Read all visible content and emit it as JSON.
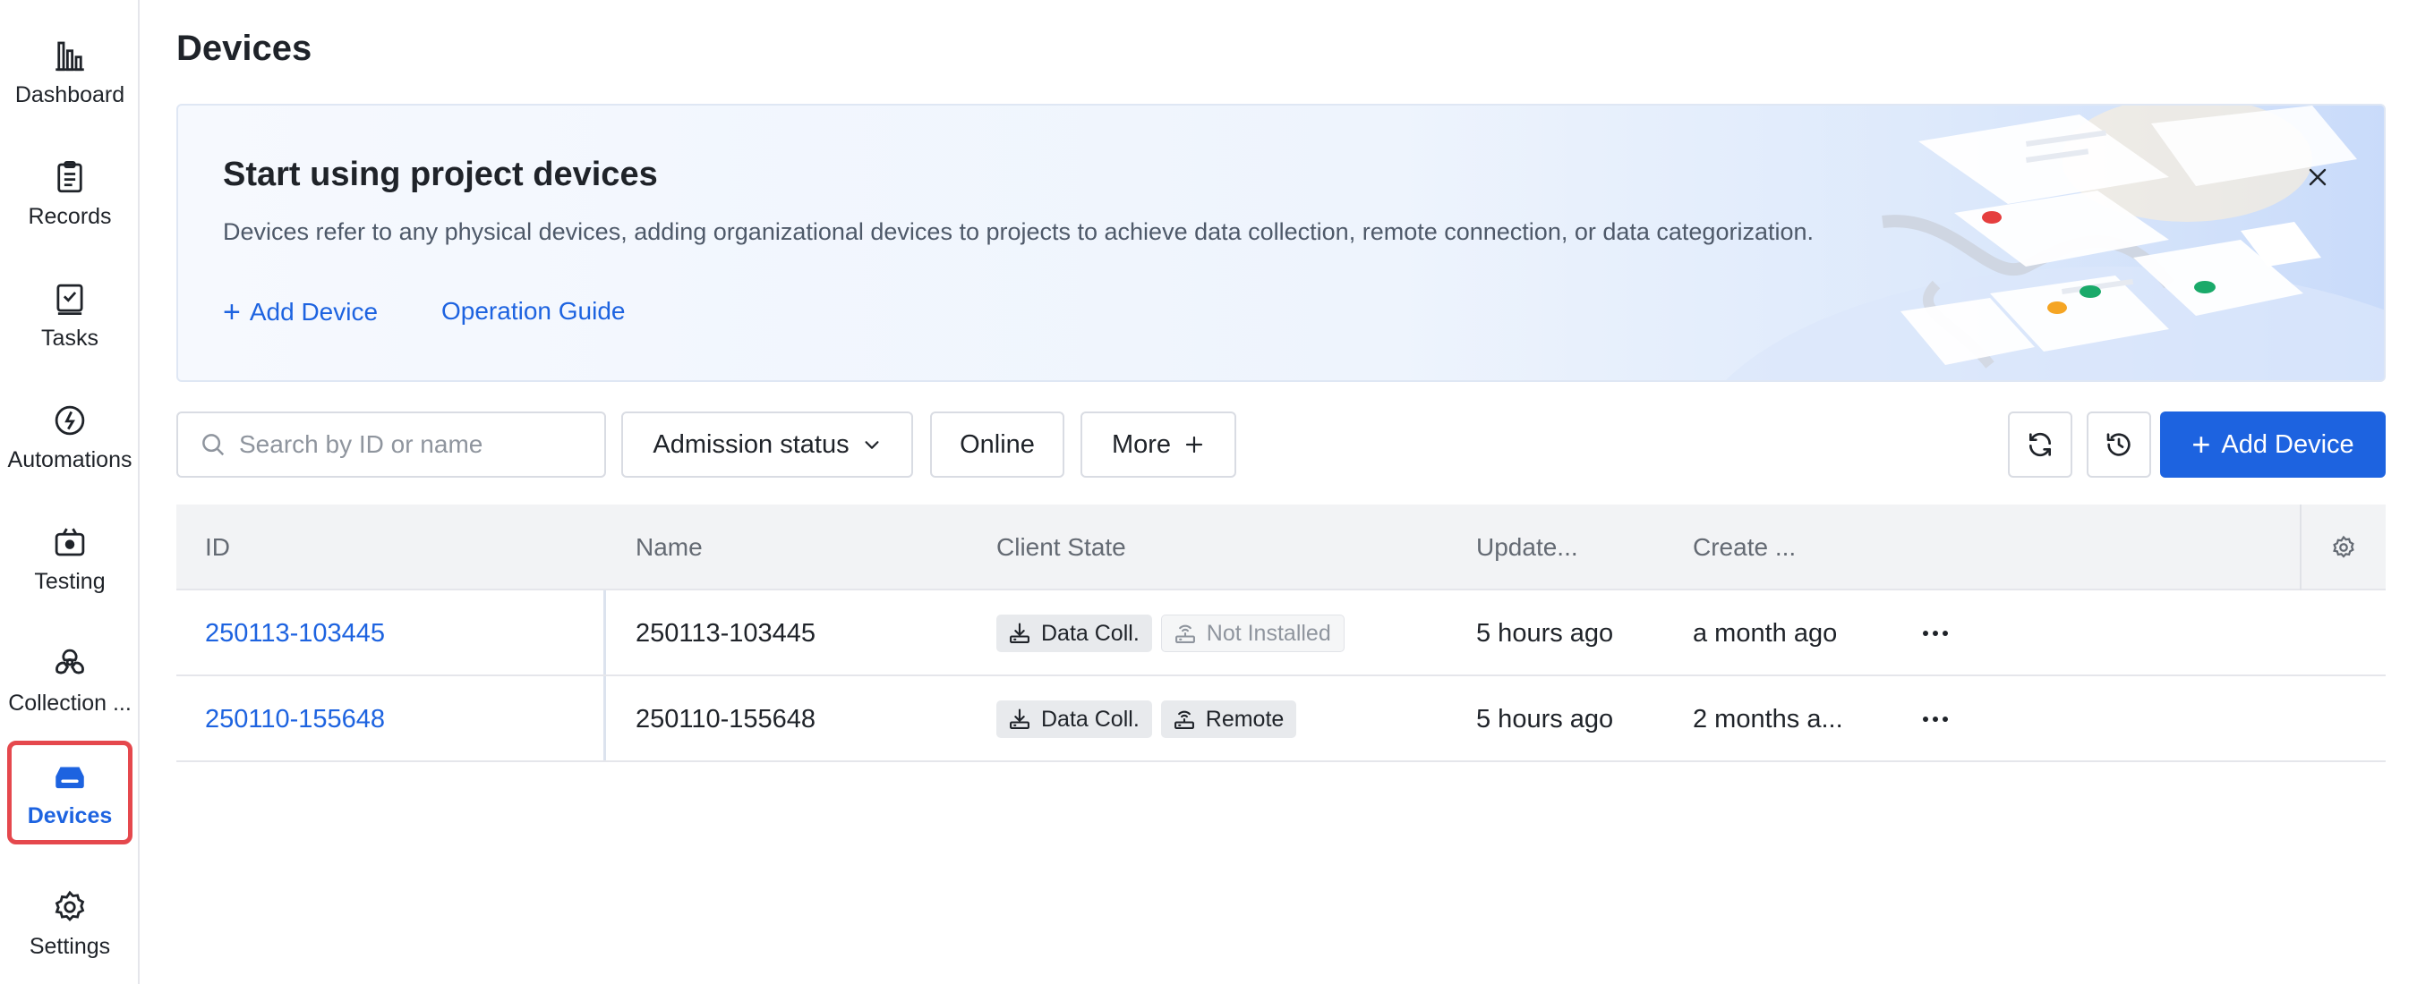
{
  "sidebar": {
    "items": [
      {
        "label": "Dashboard",
        "icon": "chart-bar-icon"
      },
      {
        "label": "Records",
        "icon": "clipboard-icon"
      },
      {
        "label": "Tasks",
        "icon": "task-check-icon"
      },
      {
        "label": "Automations",
        "icon": "automation-icon"
      },
      {
        "label": "Testing",
        "icon": "testing-icon"
      },
      {
        "label": "Collection ...",
        "icon": "collection-icon"
      },
      {
        "label": "Devices",
        "icon": "device-icon",
        "active": true
      },
      {
        "label": "Settings",
        "icon": "gear-icon"
      }
    ]
  },
  "page": {
    "title": "Devices"
  },
  "banner": {
    "title": "Start using project devices",
    "description": "Devices refer to any physical devices, adding organizational devices to projects to achieve data collection, remote connection, or data categorization.",
    "add_device_label": "Add Device",
    "operation_guide_label": "Operation Guide"
  },
  "toolbar": {
    "search_placeholder": "Search by ID or name",
    "admission_status_label": "Admission status",
    "online_label": "Online",
    "more_label": "More",
    "add_device_label": "Add Device"
  },
  "table": {
    "columns": [
      "ID",
      "Name",
      "Client State",
      "Update...",
      "Create ..."
    ],
    "rows": [
      {
        "id": "250113-103445",
        "name": "250113-103445",
        "tags": [
          "Data Coll.",
          "Not Installed"
        ],
        "updated": "5 hours ago",
        "created": "a month ago"
      },
      {
        "id": "250110-155648",
        "name": "250110-155648",
        "tags": [
          "Data Coll.",
          "Remote"
        ],
        "updated": "5 hours ago",
        "created": "2 months a..."
      }
    ]
  },
  "colors": {
    "accent": "#1d63e0",
    "active_outline": "#e5484d"
  }
}
